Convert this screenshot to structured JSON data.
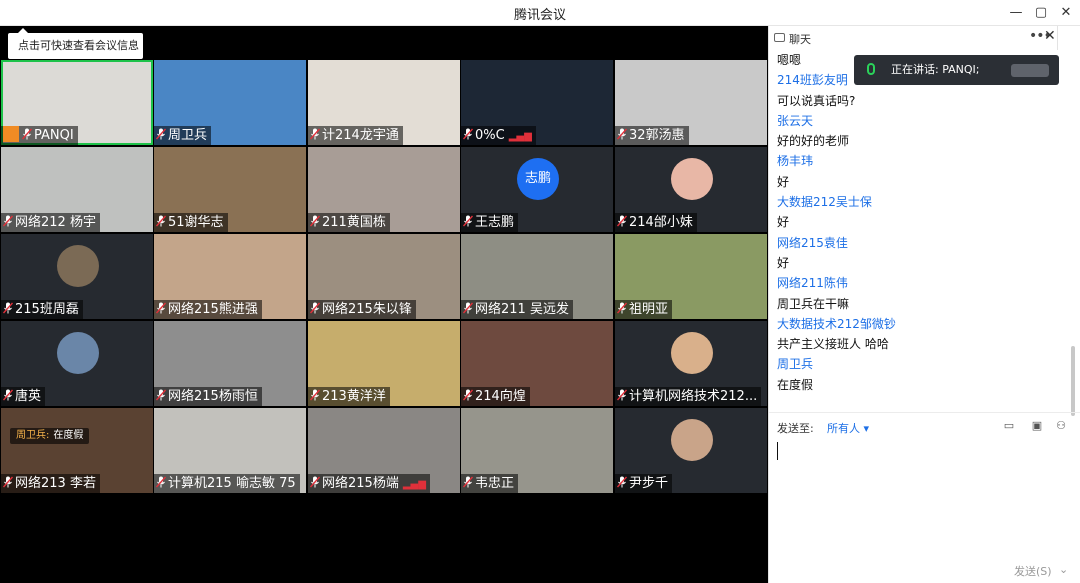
{
  "window": {
    "title": "腾讯会议",
    "controls": [
      "—",
      "▢",
      "✕"
    ]
  },
  "tooltip": "点击可快速查看会议信息",
  "participants": [
    {
      "name": "PANQI",
      "tile_bg": "#dcdad6",
      "active": true,
      "host": true
    },
    {
      "name": "周卫兵",
      "tile_bg": "#4a86c5"
    },
    {
      "name": "计214龙宇通",
      "tile_bg": "#e3ddd5"
    },
    {
      "name": "0%C",
      "tile_bg": "#1d2735",
      "signal": true
    },
    {
      "name": "32郭汤惠",
      "tile_bg": "#c9c9c9"
    },
    {
      "name": "网络212 杨宇",
      "tile_bg": "#bfc1bf"
    },
    {
      "name": "51谢华志",
      "tile_bg": "#8a7154"
    },
    {
      "name": "211黄国栋",
      "tile_bg": "#a89d96"
    },
    {
      "name": "王志鹏",
      "tile_bg": "#262a30",
      "avatar_text": "志鹏"
    },
    {
      "name": "214邰小妹",
      "tile_bg": "#262a30",
      "avatar_color": "#e8b7a6"
    },
    {
      "name": "215班周磊",
      "tile_bg": "#262a30",
      "avatar_color": "#7b6a55"
    },
    {
      "name": "网络215熊进强",
      "tile_bg": "#c3a58a"
    },
    {
      "name": "网络215朱以锋",
      "tile_bg": "#9c8f80"
    },
    {
      "name": "网络211 吴远发",
      "tile_bg": "#8e8e84"
    },
    {
      "name": "祖明亚",
      "tile_bg": "#8a9a63"
    },
    {
      "name": "唐英",
      "tile_bg": "#262a30",
      "avatar_color": "#6a86a8"
    },
    {
      "name": "网络215杨雨恒",
      "tile_bg": "#8e8e8e"
    },
    {
      "name": "213黄洋洋",
      "tile_bg": "#c6ad6c"
    },
    {
      "name": "214向煌",
      "tile_bg": "#6e4a3f"
    },
    {
      "name": "计算机网络技术212...",
      "tile_bg": "#262a30",
      "avatar_color": "#d9b08b"
    },
    {
      "name": "网络213 李若",
      "tile_bg": "#5a4232"
    },
    {
      "name": "计算机215 喻志敏 75",
      "tile_bg": "#c2c1bc"
    },
    {
      "name": "网络215杨端",
      "tile_bg": "#8a8784",
      "signal": true
    },
    {
      "name": "韦忠正",
      "tile_bg": "#96958c"
    },
    {
      "name": "尹步千",
      "tile_bg": "#262a30",
      "avatar_color": "#c9a489"
    }
  ],
  "floating_message": {
    "sender": "周卫兵:",
    "text": "在度假"
  },
  "chat": {
    "title": "聊天",
    "more": "•••",
    "close": "✕",
    "speaking": "正在讲话: PANQI;",
    "messages": [
      {
        "kind": "text",
        "value": "嗯嗯"
      },
      {
        "kind": "sender",
        "value": "214班彭友明"
      },
      {
        "kind": "text",
        "value": "可以说真话吗?"
      },
      {
        "kind": "sender",
        "value": "张云天"
      },
      {
        "kind": "text",
        "value": "好的好的老师"
      },
      {
        "kind": "sender",
        "value": "杨丰玮"
      },
      {
        "kind": "text",
        "value": "好"
      },
      {
        "kind": "sender",
        "value": "大数据212吴士保"
      },
      {
        "kind": "text",
        "value": "好"
      },
      {
        "kind": "sender",
        "value": "网络215袁佳"
      },
      {
        "kind": "text",
        "value": "好"
      },
      {
        "kind": "sender",
        "value": "网络211陈伟"
      },
      {
        "kind": "text",
        "value": "周卫兵在干嘛"
      },
      {
        "kind": "sender",
        "value": "大数据技术212邹微钞"
      },
      {
        "kind": "text",
        "value": "共产主义接班人 哈哈"
      },
      {
        "kind": "sender",
        "value": "周卫兵"
      },
      {
        "kind": "text",
        "value": "在度假"
      }
    ],
    "send_to_label": "发送至:",
    "recipient": "所有人 ▾",
    "send_button": "发送(S)",
    "send_dropdown": "⌄"
  }
}
